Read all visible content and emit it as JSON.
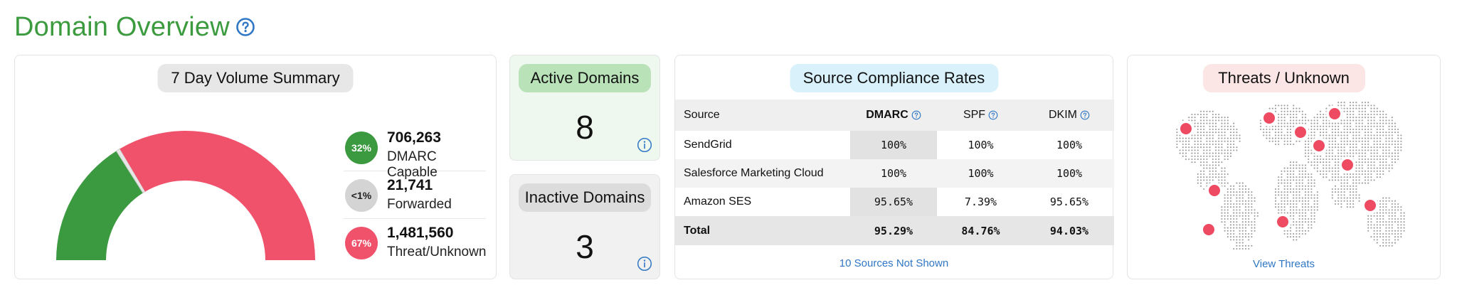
{
  "header": {
    "title": "Domain Overview",
    "help_icon": "question-circle-icon"
  },
  "volume_summary": {
    "title": "7 Day Volume Summary",
    "gauge": {
      "green_fraction": 0.32,
      "gray_fraction": 0.01,
      "red_fraction": 0.67
    },
    "items": [
      {
        "badge": "32%",
        "value": "706,263",
        "label": "DMARC Capable",
        "color": "#3b9a3f"
      },
      {
        "badge": "<1%",
        "value": "21,741",
        "label": "Forwarded",
        "color": "#d4d4d4"
      },
      {
        "badge": "67%",
        "value": "1,481,560",
        "label": "Threat/Unknown",
        "color": "#f0526b"
      }
    ]
  },
  "active_domains": {
    "title": "Active Domains",
    "count": "8",
    "icon": "info-icon"
  },
  "inactive_domains": {
    "title": "Inactive Domains",
    "count": "3",
    "icon": "info-icon"
  },
  "compliance": {
    "title": "Source Compliance Rates",
    "columns": [
      "Source",
      "DMARC",
      "SPF",
      "DKIM"
    ],
    "rows": [
      {
        "source": "SendGrid",
        "dmarc": "100%",
        "spf": "100%",
        "dkim": "100%"
      },
      {
        "source": "Salesforce Marketing Cloud",
        "dmarc": "100%",
        "spf": "100%",
        "dkim": "100%"
      },
      {
        "source": "Amazon SES",
        "dmarc": "95.65%",
        "spf": "7.39%",
        "dkim": "95.65%"
      }
    ],
    "total": {
      "source": "Total",
      "dmarc": "95.29%",
      "spf": "84.76%",
      "dkim": "94.03%"
    },
    "footer_link": "10 Sources Not Shown"
  },
  "threats": {
    "title": "Threats / Unknown",
    "footer_link": "View Threats",
    "marker_color": "#ee4a62"
  }
}
